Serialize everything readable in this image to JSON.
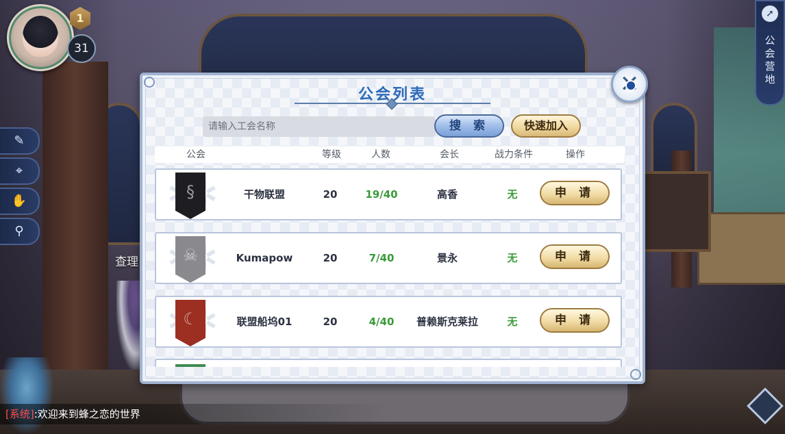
{
  "hud": {
    "level_badge": "1",
    "level_number": "31",
    "npc_text": "查理",
    "right_tab_label": "公会营地",
    "side_icons": [
      "chat-icon",
      "map-pin-icon",
      "handshake-icon",
      "magnifier-icon"
    ]
  },
  "chat": {
    "tag": "[系统]",
    "message": ":欢迎来到蜂之恋的世界"
  },
  "modal": {
    "title": "公会列表",
    "search": {
      "placeholder": "请输入工会名称",
      "button_label": "搜 索"
    },
    "quick_join_label": "快速加入",
    "columns": {
      "guild": "公会",
      "level": "等级",
      "members": "人数",
      "leader": "会长",
      "power_req": "战力条件",
      "action": "操作"
    },
    "guilds": [
      {
        "name": "干物联盟",
        "level": "20",
        "members": "19/40",
        "leader": "高香",
        "power_req": "无",
        "action": "申 请",
        "banner_color": "#1e1e22",
        "emblem": "dragon-emblem"
      },
      {
        "name": "Kumapow",
        "level": "20",
        "members": "7/40",
        "leader": "景永",
        "power_req": "无",
        "action": "申 请",
        "banner_color": "#8a8a8e",
        "emblem": "skull-emblem"
      },
      {
        "name": "联盟船坞01",
        "level": "20",
        "members": "4/40",
        "leader": "普赖斯克莱拉",
        "power_req": "无",
        "action": "申 请",
        "banner_color": "#9c2e22",
        "emblem": "moon-emblem"
      }
    ],
    "partial_row_banner_color": "#3f8a52"
  },
  "colors": {
    "title_blue": "#2e6bb8",
    "member_green": "#3a9a3a",
    "button_gold": "#f2dca6",
    "button_blue": "#9fbde8"
  }
}
